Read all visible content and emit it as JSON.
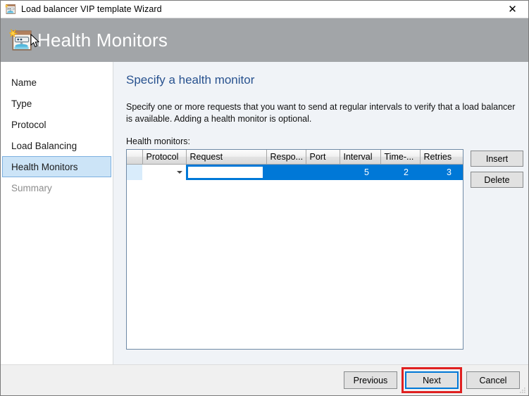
{
  "window": {
    "title": "Load balancer VIP template Wizard",
    "title_icon": "wizard-page-icon",
    "close_label": "✕"
  },
  "banner": {
    "heading": "Health Monitors",
    "icon": "wizard-page-icon",
    "background_color": "#a2a5a8"
  },
  "sidebar": {
    "items": [
      {
        "label": "Name",
        "state": "normal"
      },
      {
        "label": "Type",
        "state": "normal"
      },
      {
        "label": "Protocol",
        "state": "normal"
      },
      {
        "label": "Load Balancing",
        "state": "normal"
      },
      {
        "label": "Health Monitors",
        "state": "selected"
      },
      {
        "label": "Summary",
        "state": "disabled"
      }
    ],
    "selected_color": "#cce4f7",
    "selected_border_color": "#7cb0e0"
  },
  "main": {
    "heading": "Specify a health monitor",
    "heading_color": "#28528f",
    "description": "Specify one or more requests that you want to send at regular intervals to verify that a load balancer is available. Adding a health monitor is optional.",
    "grid_label": "Health monitors:"
  },
  "grid": {
    "columns": [
      {
        "key": "selector",
        "header": ""
      },
      {
        "key": "protocol",
        "header": "Protocol"
      },
      {
        "key": "request",
        "header": "Request"
      },
      {
        "key": "response",
        "header": "Respo..."
      },
      {
        "key": "port",
        "header": "Port"
      },
      {
        "key": "interval",
        "header": "Interval"
      },
      {
        "key": "timeout",
        "header": "Time-..."
      },
      {
        "key": "retries",
        "header": "Retries"
      }
    ],
    "rows": [
      {
        "selected": true,
        "protocol": "",
        "protocol_placeholder": "",
        "request": "",
        "request_focused": true,
        "response": "",
        "port": "",
        "interval": "5",
        "timeout": "2",
        "retries": "3"
      }
    ],
    "selection_color": "#0078d7",
    "row_selector_color": "#d9ecfb"
  },
  "side_buttons": {
    "insert_label": "Insert",
    "delete_label": "Delete"
  },
  "footer": {
    "previous_label": "Previous",
    "next_label": "Next",
    "cancel_label": "Cancel",
    "default_button": "Next",
    "highlight_color": "#e02020",
    "focus_color": "#0078d7"
  }
}
